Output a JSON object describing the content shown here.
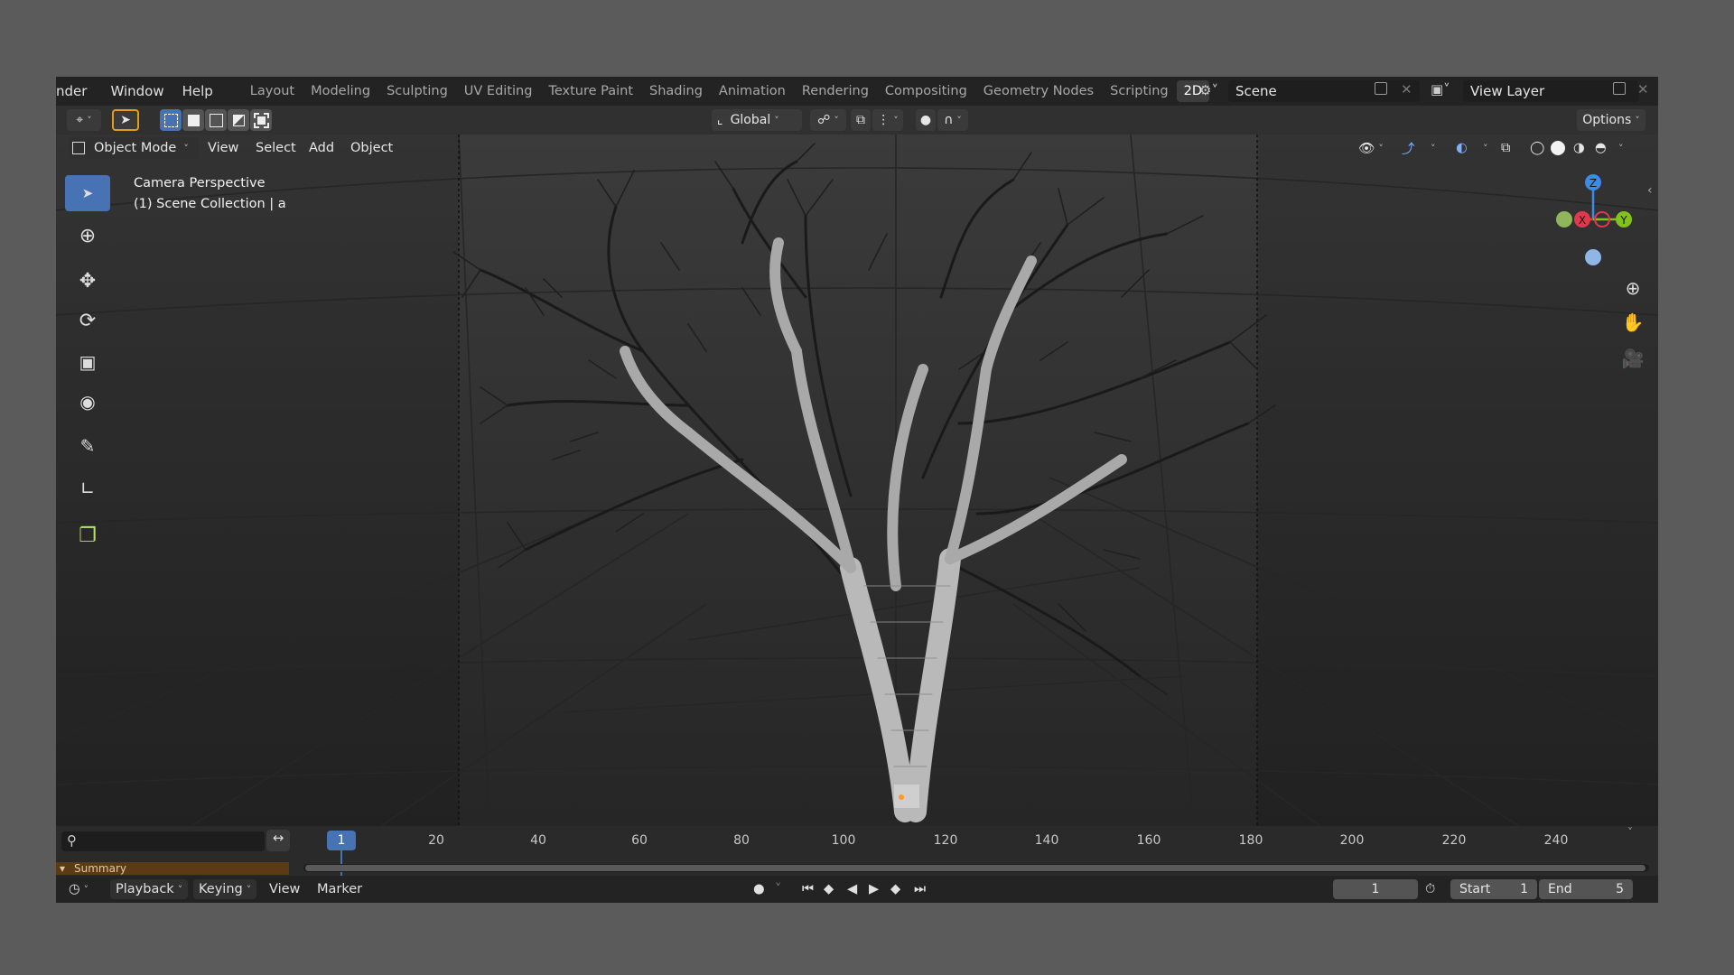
{
  "menubar": {
    "items": [
      "nder",
      "Window",
      "Help"
    ],
    "workspace_tabs": [
      "Layout",
      "Modeling",
      "Sculpting",
      "UV Editing",
      "Texture Paint",
      "Shading",
      "Animation",
      "Rendering",
      "Compositing",
      "Geometry Nodes",
      "Scripting",
      "2D"
    ],
    "active_tab": "2D",
    "scene": "Scene",
    "view_layer": "View Layer"
  },
  "toolbar": {
    "transform_orientation": "Global",
    "options_label": "Options"
  },
  "viewport_header": {
    "mode": "Object Mode",
    "menus": [
      "View",
      "Select",
      "Add",
      "Object"
    ]
  },
  "viewport": {
    "overlay_line1": "Camera Perspective",
    "overlay_line2": "(1) Scene Collection | a",
    "gizmo": {
      "z": "Z",
      "x": "X",
      "y": "Y"
    }
  },
  "timeline": {
    "current_frame": "1",
    "frame_labels": [
      "20",
      "40",
      "60",
      "80",
      "100",
      "120",
      "140",
      "160",
      "180",
      "200",
      "220",
      "240"
    ],
    "summary_label": "Summary"
  },
  "playback": {
    "playback_label": "Playback",
    "keying_label": "Keying",
    "view_label": "View",
    "marker_label": "Marker",
    "frame_value": "1",
    "start_label": "Start",
    "start_value": "1",
    "end_label": "End",
    "end_value": "5"
  },
  "colors": {
    "accent": "#4772b3",
    "axis_x": "#e2384e",
    "axis_y": "#82c21b",
    "axis_z": "#3a8ce6"
  }
}
